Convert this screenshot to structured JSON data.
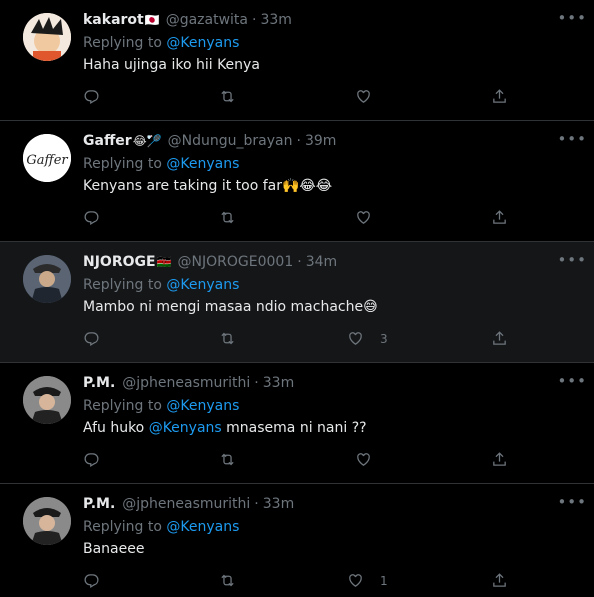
{
  "tweets": [
    {
      "name": "kakarot",
      "handle": "@gazatwita",
      "time": "33m",
      "replying_prefix": "Replying to",
      "replying_to": "@Kenyans",
      "text_before": "Haha ujinga iko hii Kenya",
      "mention": "",
      "text_after": "",
      "emoji": "🇯🇵",
      "likes": "",
      "highlight": false,
      "avatar_color": "#c0392b"
    },
    {
      "name": "Gaffer",
      "handle": "@Ndungu_brayan",
      "time": "39m",
      "replying_prefix": "Replying to",
      "replying_to": "@Kenyans",
      "text_before": "Kenyans are taking it too far",
      "mention": "",
      "text_after": "🙌😂😂",
      "emoji": "😂🏸",
      "likes": "",
      "highlight": false,
      "avatar_color": "#ffffff"
    },
    {
      "name": "NJOROGE",
      "handle": "@NJOROGE0001",
      "time": "34m",
      "replying_prefix": "Replying to",
      "replying_to": "@Kenyans",
      "text_before": "Mambo ni mengi masaa ndio machache",
      "mention": "",
      "text_after": "😅",
      "emoji": "🇰🇪",
      "likes": "3",
      "highlight": true,
      "avatar_color": "#3b4a5c"
    },
    {
      "name": "P.M.",
      "handle": "@jpheneasmurithi",
      "time": "33m",
      "replying_prefix": "Replying to",
      "replying_to": "@Kenyans",
      "text_before": "Afu huko ",
      "mention": "@Kenyans",
      "text_after": " mnasema ni nani ??",
      "emoji": "",
      "likes": "",
      "highlight": false,
      "avatar_color": "#6b6b6b"
    },
    {
      "name": "P.M.",
      "handle": "@jpheneasmurithi",
      "time": "33m",
      "replying_prefix": "Replying to",
      "replying_to": "@Kenyans",
      "text_before": "Banaeee",
      "mention": "",
      "text_after": "",
      "emoji": "",
      "likes": "1",
      "highlight": false,
      "avatar_color": "#6b6b6b"
    }
  ],
  "icons": {
    "reply": "reply-icon",
    "retweet": "retweet-icon",
    "like": "like-icon",
    "share": "share-icon",
    "more": "more-icon"
  },
  "colors": {
    "background": "#000000",
    "link": "#1d9bf0",
    "muted": "#6e767d",
    "text": "#e7e9ea",
    "highlight_bg": "#151618"
  }
}
